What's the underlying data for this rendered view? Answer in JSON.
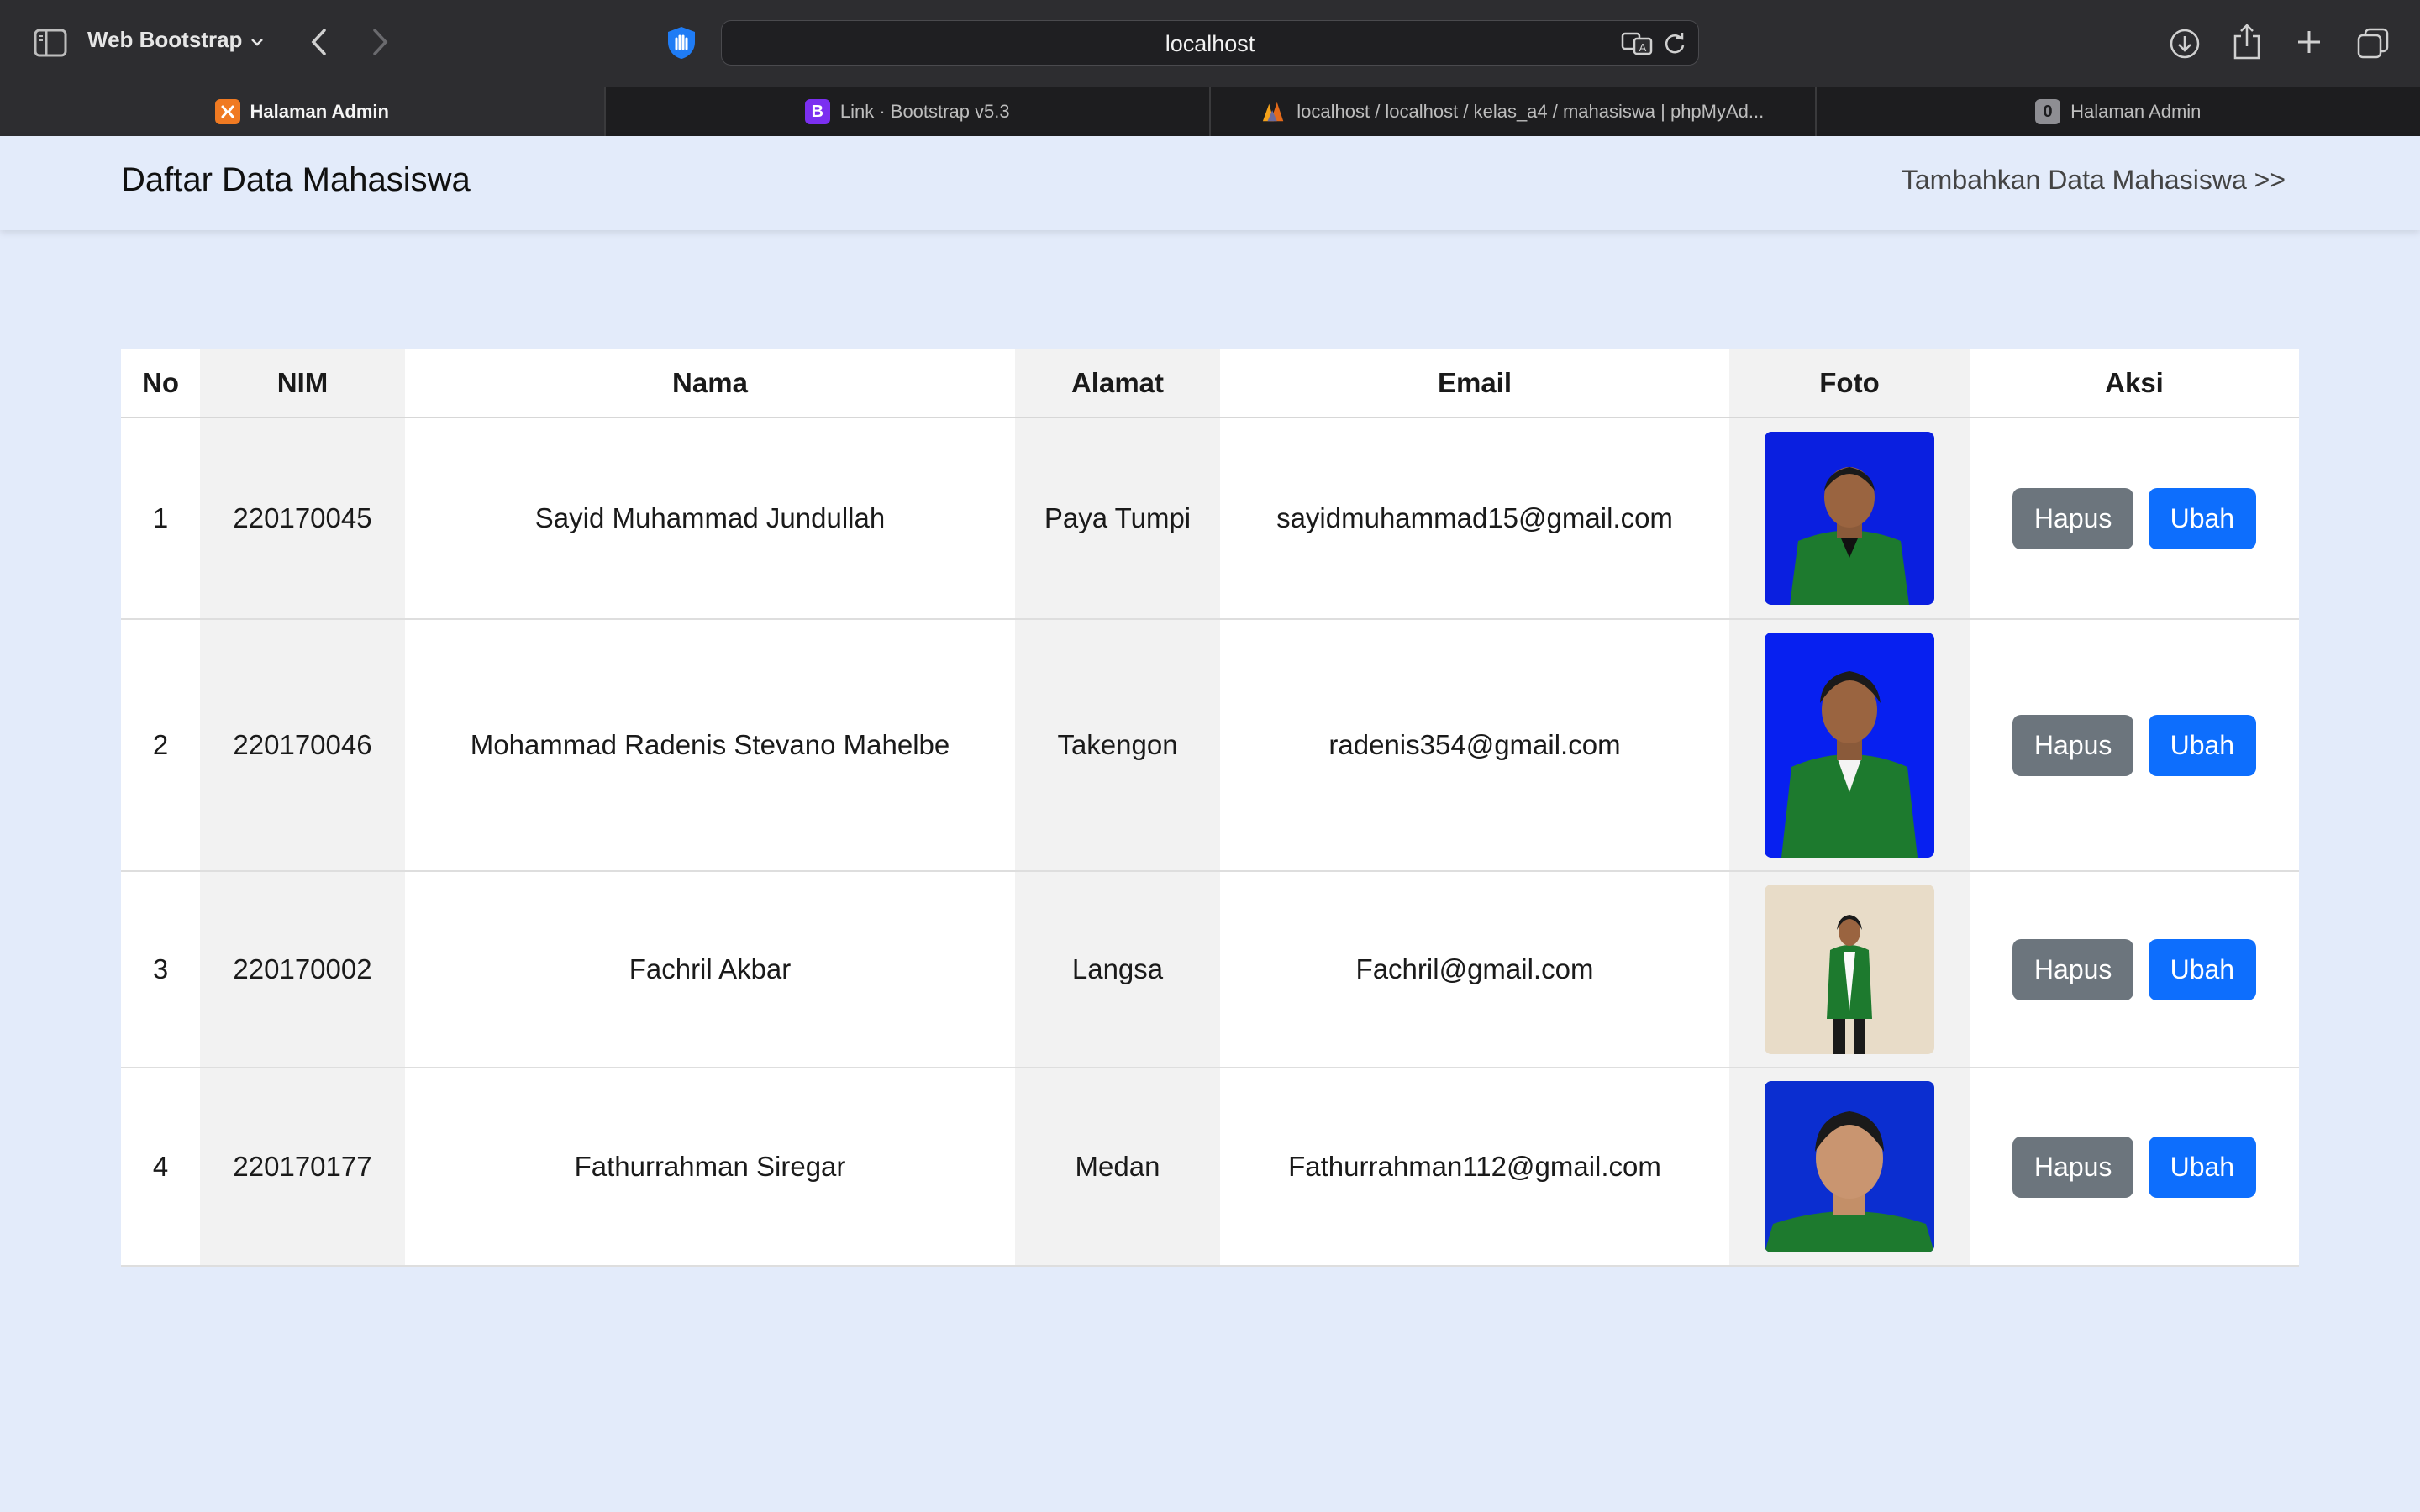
{
  "browser": {
    "profile_name": "Web Bootstrap",
    "url": "localhost",
    "tabs": [
      {
        "label": "Halaman Admin",
        "icon": "xampp-icon",
        "favicon_text": "",
        "active": true
      },
      {
        "label": "Link · Bootstrap v5.3",
        "icon": "bootstrap-icon",
        "favicon_text": "B",
        "active": false
      },
      {
        "label": "localhost / localhost / kelas_a4 / mahasiswa | phpMyAd...",
        "icon": "phpmyadmin-icon",
        "favicon_text": "",
        "active": false
      },
      {
        "label": "Halaman Admin",
        "icon": "zero-badge-icon",
        "favicon_text": "0",
        "active": false
      }
    ]
  },
  "navbar": {
    "brand": "Daftar Data Mahasiswa",
    "add_link": "Tambahkan Data Mahasiswa >>"
  },
  "table": {
    "headers": {
      "no": "No",
      "nim": "NIM",
      "nama": "Nama",
      "alamat": "Alamat",
      "email": "Email",
      "foto": "Foto",
      "aksi": "Aksi"
    },
    "rows": [
      {
        "no": "1",
        "nim": "220170045",
        "nama": "Sayid Muhammad Jundullah",
        "alamat": "Paya Tumpi",
        "email": "sayidmuhammad15@gmail.com",
        "photo_bg": "#0a1fe0",
        "delete_label": "Hapus",
        "edit_label": "Ubah"
      },
      {
        "no": "2",
        "nim": "220170046",
        "nama": "Mohammad Radenis Stevano Mahelbe",
        "alamat": "Takengon",
        "email": "radenis354@gmail.com",
        "photo_bg": "#0720f0",
        "delete_label": "Hapus",
        "edit_label": "Ubah"
      },
      {
        "no": "3",
        "nim": "220170002",
        "nama": "Fachril Akbar",
        "alamat": "Langsa",
        "email": "Fachril@gmail.com",
        "photo_bg": "#e8dcc8",
        "delete_label": "Hapus",
        "edit_label": "Ubah"
      },
      {
        "no": "4",
        "nim": "220170177",
        "nama": "Fathurrahman Siregar",
        "alamat": "Medan",
        "email": "Fathurrahman112@gmail.com",
        "photo_bg": "#0b2ed0",
        "delete_label": "Hapus",
        "edit_label": "Ubah"
      }
    ]
  },
  "colors": {
    "page_bg": "#e3ebfa",
    "btn_delete": "#6c757d",
    "btn_edit": "#0d6efd",
    "jacket_green": "#1d7a2e"
  }
}
